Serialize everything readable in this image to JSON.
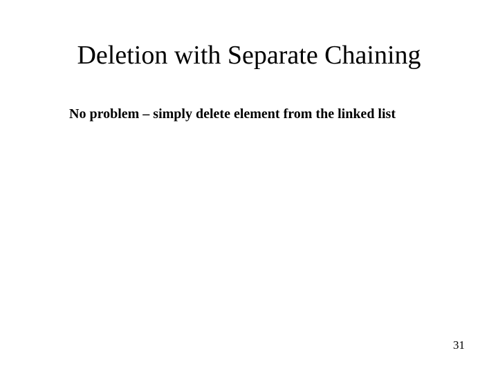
{
  "slide": {
    "title": "Deletion with Separate Chaining",
    "body": "No problem – simply delete element from the linked list",
    "page_number": "31"
  }
}
